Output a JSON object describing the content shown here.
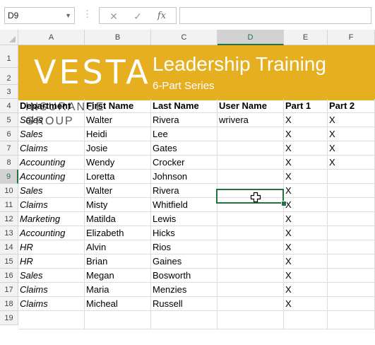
{
  "namebox": {
    "value": "D9"
  },
  "formula": {
    "cancel_icon": "✕",
    "enter_icon": "✓",
    "fx_label": "fx",
    "value": ""
  },
  "columns": [
    "A",
    "B",
    "C",
    "D",
    "E",
    "F"
  ],
  "selected_column": "D",
  "rows": [
    "1",
    "2",
    "3",
    "4",
    "5",
    "6",
    "7",
    "8",
    "9",
    "10",
    "11",
    "12",
    "13",
    "14",
    "15",
    "16",
    "17",
    "18",
    "19"
  ],
  "selected_row": "9",
  "banner": {
    "logo": "VESTA",
    "title": "Leadership Training",
    "subtitle": "6-Part Series",
    "tagline": "INSURANCE  GROUP",
    "color": "#e6af20"
  },
  "table": {
    "headers": [
      "Department",
      "First Name",
      "Last Name",
      "User Name",
      "Part 1",
      "Part 2"
    ],
    "rows": [
      [
        "Sales",
        "Walter",
        "Rivera",
        "wrivera",
        "X",
        "X"
      ],
      [
        "Sales",
        "Heidi",
        "Lee",
        "",
        "X",
        "X"
      ],
      [
        "Claims",
        "Josie",
        "Gates",
        "",
        "X",
        "X"
      ],
      [
        "Accounting",
        "Wendy",
        "Crocker",
        "",
        "X",
        "X"
      ],
      [
        "Accounting",
        "Loretta",
        "Johnson",
        "",
        "X",
        ""
      ],
      [
        "Sales",
        "Walter",
        "Rivera",
        "",
        "X",
        ""
      ],
      [
        "Claims",
        "Misty",
        "Whitfield",
        "",
        "X",
        ""
      ],
      [
        "Marketing",
        "Matilda",
        "Lewis",
        "",
        "X",
        ""
      ],
      [
        "Accounting",
        "Elizabeth",
        "Hicks",
        "",
        "X",
        ""
      ],
      [
        "HR",
        "Alvin",
        "Rios",
        "",
        "X",
        ""
      ],
      [
        "HR",
        "Brian",
        "Gaines",
        "",
        "X",
        ""
      ],
      [
        "Sales",
        "Megan",
        "Bosworth",
        "",
        "X",
        ""
      ],
      [
        "Claims",
        "Maria",
        "Menzies",
        "",
        "X",
        ""
      ],
      [
        "Claims",
        "Micheal",
        "Russell",
        "",
        "X",
        ""
      ]
    ]
  },
  "accent_color": "#217346"
}
